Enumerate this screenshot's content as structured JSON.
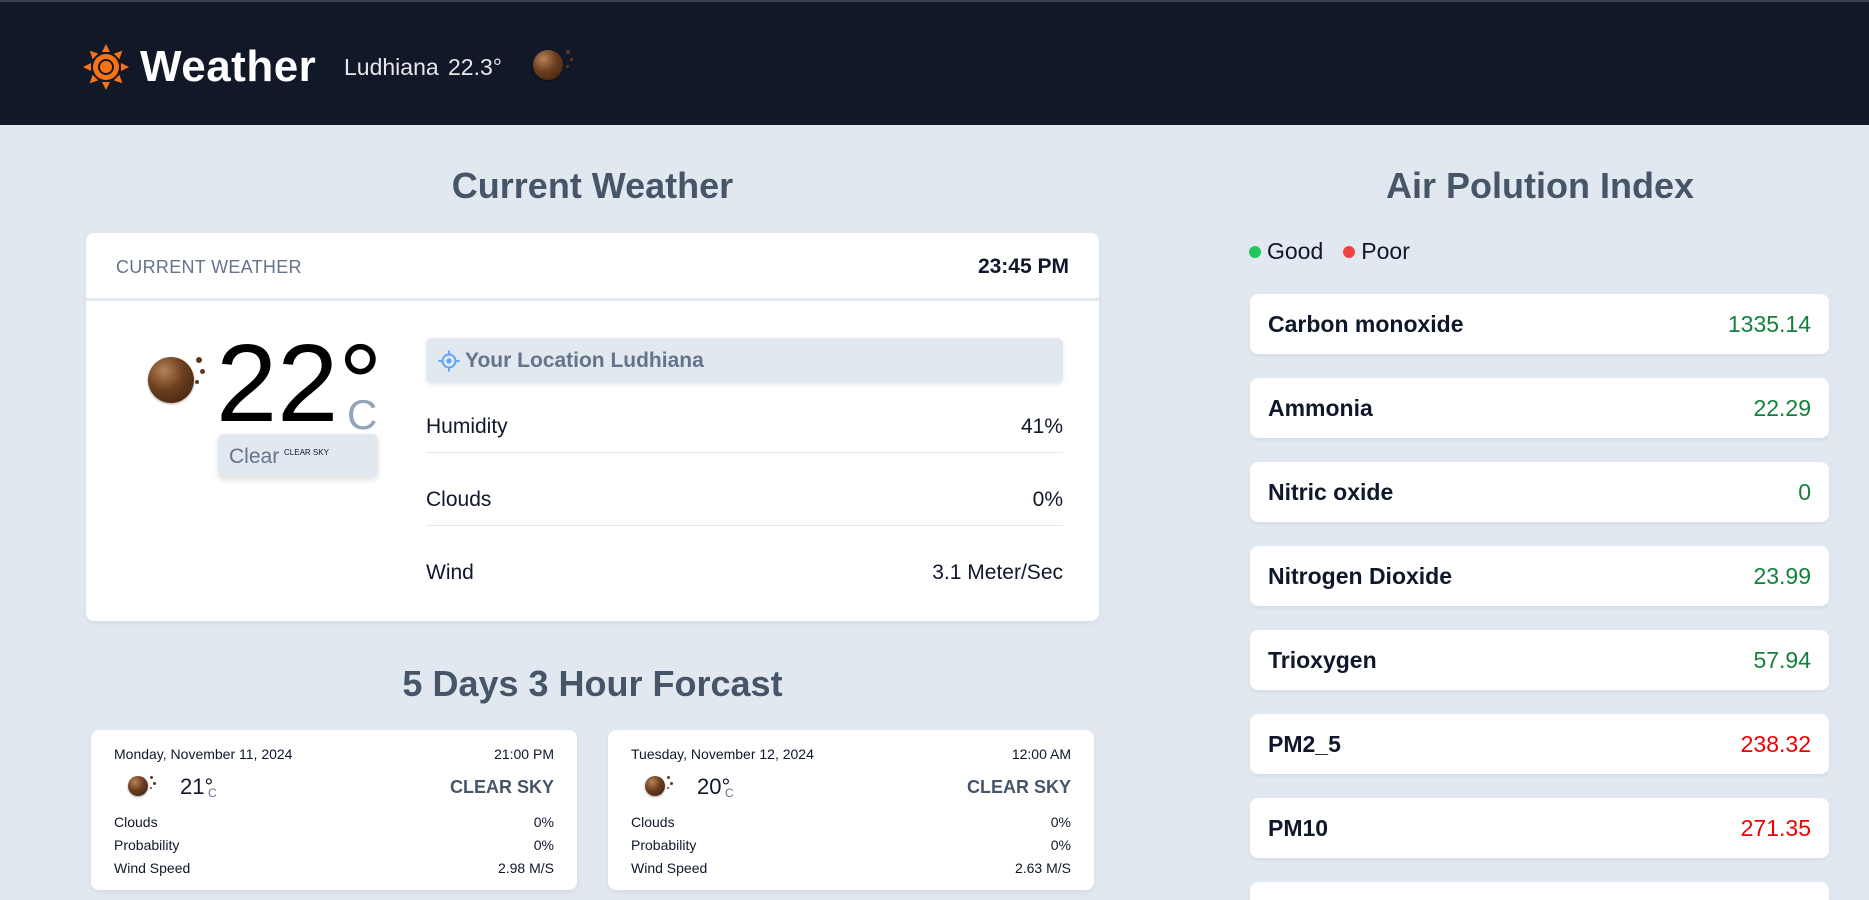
{
  "header": {
    "brand": "Weather",
    "city": "Ludhiana",
    "temp": "22.3°",
    "icon": "moon-icon"
  },
  "current": {
    "section_title": "Current Weather",
    "card_label": "CURRENT WEATHER",
    "time": "23:45 PM",
    "temp": "22°",
    "unit": "C",
    "condition": "Clear",
    "condition_sub": "CLEAR SKY",
    "location": "Your Location Ludhiana",
    "stats": [
      {
        "label": "Humidity",
        "value": "41%"
      },
      {
        "label": "Clouds",
        "value": "0%"
      },
      {
        "label": "Wind",
        "value": "3.1 Meter/Sec"
      }
    ]
  },
  "forecast": {
    "section_title": "5 Days 3 Hour Forcast",
    "cards": [
      {
        "date": "Monday, November 11, 2024",
        "time": "21:00 PM",
        "temp": "21°",
        "unit": "C",
        "desc": "CLEAR SKY",
        "rows": [
          {
            "label": "Clouds",
            "value": "0%"
          },
          {
            "label": "Probability",
            "value": "0%"
          },
          {
            "label": "Wind Speed",
            "value": "2.98 M/S"
          }
        ]
      },
      {
        "date": "Tuesday, November 12, 2024",
        "time": "12:00 AM",
        "temp": "20°",
        "unit": "C",
        "desc": "CLEAR SKY",
        "rows": [
          {
            "label": "Clouds",
            "value": "0%"
          },
          {
            "label": "Probability",
            "value": "0%"
          },
          {
            "label": "Wind Speed",
            "value": "2.63 M/S"
          }
        ]
      }
    ]
  },
  "air": {
    "section_title": "Air Polution Index",
    "legend": [
      {
        "label": "Good",
        "color": "#22c55e"
      },
      {
        "label": "Poor",
        "color": "#ef4444"
      }
    ],
    "colors": {
      "good": "#15803d",
      "poor": "#ef0000"
    },
    "items": [
      {
        "name": "Carbon monoxide",
        "value": "1335.14",
        "status": "good"
      },
      {
        "name": "Ammonia",
        "value": "22.29",
        "status": "good"
      },
      {
        "name": "Nitric oxide",
        "value": "0",
        "status": "good"
      },
      {
        "name": "Nitrogen Dioxide",
        "value": "23.99",
        "status": "good"
      },
      {
        "name": "Trioxygen",
        "value": "57.94",
        "status": "good"
      },
      {
        "name": "PM2_5",
        "value": "238.32",
        "status": "poor"
      },
      {
        "name": "PM10",
        "value": "271.35",
        "status": "poor"
      }
    ]
  }
}
